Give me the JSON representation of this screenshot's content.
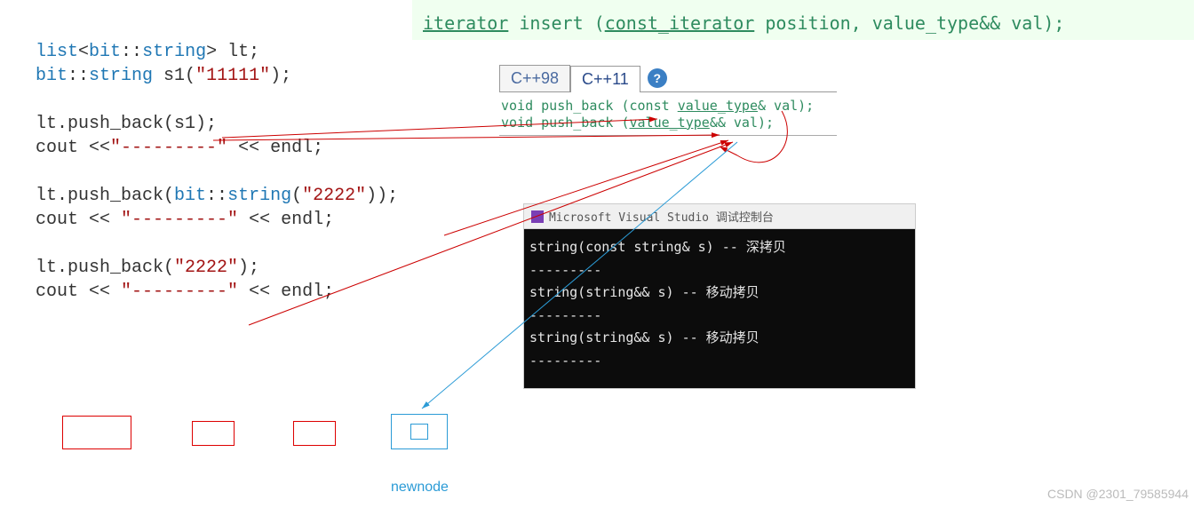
{
  "code": {
    "l1_p1": "list",
    "l1_p2": "<",
    "l1_p3": "bit",
    "l1_p4": "::",
    "l1_p5": "string",
    "l1_p6": "> lt;",
    "l2_p1": "bit",
    "l2_p2": "::",
    "l2_p3": "string",
    "l2_p4": " s1(",
    "l2_p5": "\"11111\"",
    "l2_p6": ");",
    "l3_p1": "lt.push_back(s1);",
    "l4_p1": "cout",
    "l4_p2": " <<",
    "l4_p3": "\"---------\"",
    "l4_p4": " << ",
    "l4_p5": "endl;",
    "l5_p1": "lt.push_back(",
    "l5_p2": "bit",
    "l5_p3": "::",
    "l5_p4": "string",
    "l5_p5": "(",
    "l5_p6": "\"2222\"",
    "l5_p7": "));",
    "l6_p1": "cout",
    "l6_p2": " << ",
    "l6_p3": "\"---------\"",
    "l6_p4": " << ",
    "l6_p5": "endl;",
    "l7_p1": "lt.push_back(",
    "l7_p2": "\"2222\"",
    "l7_p3": ");",
    "l8_p1": "cout",
    "l8_p2": " << ",
    "l8_p3": "\"---------\"",
    "l8_p4": " << ",
    "l8_p5": "endl;"
  },
  "banner": {
    "p1": "iterator",
    "p2": " insert (",
    "p3": "const_iterator",
    "p4": " position, value_type&& val);"
  },
  "tabs": {
    "inactive": "C++98",
    "active": "C++11",
    "help": "?"
  },
  "signatures": {
    "s1_a": "void push_back (const ",
    "s1_b": "value_type",
    "s1_c": "& val);",
    "s2_a": "void push_back (",
    "s2_b": "value_type",
    "s2_c": "&& val);"
  },
  "console": {
    "title": "Microsoft Visual Studio 调试控制台",
    "icon": "VS",
    "line1": "string(const string& s) -- 深拷贝",
    "sep1": "---------",
    "line2": "string(string&& s) -- 移动拷贝",
    "sep2": "---------",
    "line3": "string(string&& s) -- 移动拷贝",
    "sep3": "---------"
  },
  "newnode": "newnode",
  "watermark": "CSDN @2301_79585944"
}
